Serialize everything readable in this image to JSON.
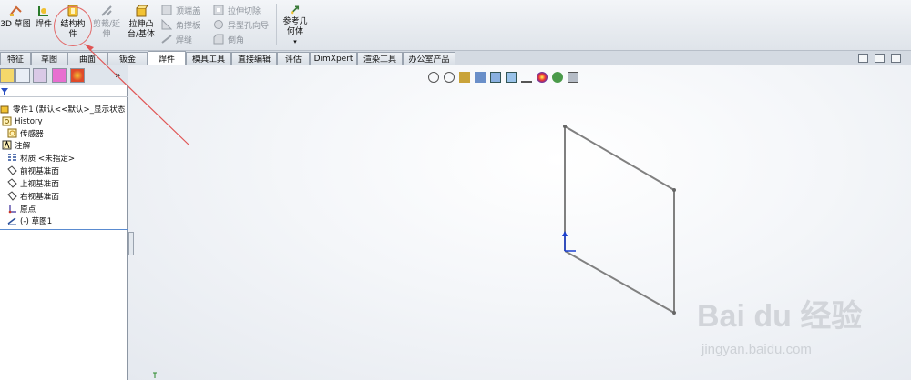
{
  "toolbar": {
    "items": [
      {
        "label_1": "3D 草图",
        "label_2": ""
      },
      {
        "label_1": "焊件",
        "label_2": ""
      },
      {
        "label_1": "结构构",
        "label_2": "件"
      },
      {
        "label_1": "剪裁/延",
        "label_2": "伸"
      },
      {
        "label_1": "拉伸凸",
        "label_2": "台/基体"
      }
    ],
    "small": [
      "顶端盖",
      "角撑板",
      "焊缝",
      "拉伸切除",
      "异型孔向导",
      "倒角"
    ],
    "ref_geom": {
      "label_1": "参考几",
      "label_2": "何体"
    }
  },
  "tabs": [
    "特征",
    "草图",
    "曲面",
    "钣金",
    "焊件",
    "模具工具",
    "直接编辑",
    "评估",
    "DimXpert",
    "渲染工具",
    "办公室产品"
  ],
  "active_tab": "焊件",
  "tree": {
    "root": "零件1 (默认<<默认>_显示状态",
    "items": [
      "History",
      "传感器",
      "注解",
      "材质 <未指定>",
      "前视基准面",
      "上视基准面",
      "右视基准面",
      "原点",
      "(-) 草图1"
    ]
  },
  "panel_expand": "»",
  "watermark": {
    "big": "Bai du 经验",
    "small": "jingyan.baidu.com"
  },
  "colors": {
    "annotation": "#e05555",
    "sketch_line": "#808080",
    "axis": "#1a3fd0"
  }
}
